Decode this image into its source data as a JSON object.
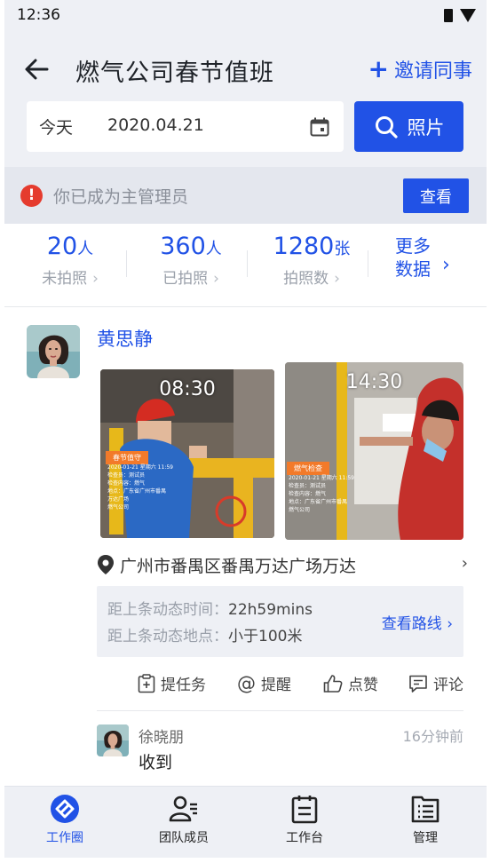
{
  "status_bar": {
    "time": "12:36"
  },
  "header": {
    "title": "燃气公司春节值班",
    "invite_label": "邀请同事",
    "date_label": "今天",
    "date_value": "2020.04.21",
    "photo_button_label": "照片"
  },
  "notice": {
    "text": "你已成为主管理员",
    "view_button": "查看"
  },
  "stats": [
    {
      "number": "20",
      "unit": "人",
      "label": "未拍照"
    },
    {
      "number": "360",
      "unit": "人",
      "label": "已拍照"
    },
    {
      "number": "1280",
      "unit": "张",
      "label": "拍照数"
    }
  ],
  "more_data": {
    "line1": "更多",
    "line2": "数据"
  },
  "post": {
    "author": "黄思静",
    "photos": [
      {
        "time": "08:30",
        "stamp_title": "春节值守",
        "stamp_lines": [
          "2020-01-21 星期六 11:59",
          "检查员：测试员",
          "检查内容：燃气",
          "地点：广东省广州市番禺",
          "万达广场",
          "燃气公司"
        ]
      },
      {
        "time": "14:30",
        "stamp_title": "燃气检查",
        "stamp_lines": [
          "2020-01-21 星期六 11:59",
          "检查员：测试员",
          "检查内容：燃气",
          "地点：广东省广州市番禺",
          "燃气公司"
        ]
      }
    ],
    "location": "广州市番禺区番禺万达广场万达",
    "info": {
      "time_label": "距上条动态时间：",
      "time_value": "22h59mins",
      "place_label": "距上条动态地点：",
      "place_value": "小于100米",
      "route_link": "查看路线"
    },
    "actions": {
      "task": "提任务",
      "remind": "提醒",
      "like": "点赞",
      "comment": "评论"
    },
    "comment": {
      "author": "徐晓朋",
      "time": "16分钟前",
      "text": "收到"
    }
  },
  "tabs": [
    {
      "label": "工作圈",
      "active": true
    },
    {
      "label": "团队成员",
      "active": false
    },
    {
      "label": "工作台",
      "active": false
    },
    {
      "label": "管理",
      "active": false
    }
  ],
  "colors": {
    "accent": "#2152e6",
    "warning": "#e53b2e",
    "background": "#eef0f5",
    "stamp_orange": "#f27a2a"
  }
}
